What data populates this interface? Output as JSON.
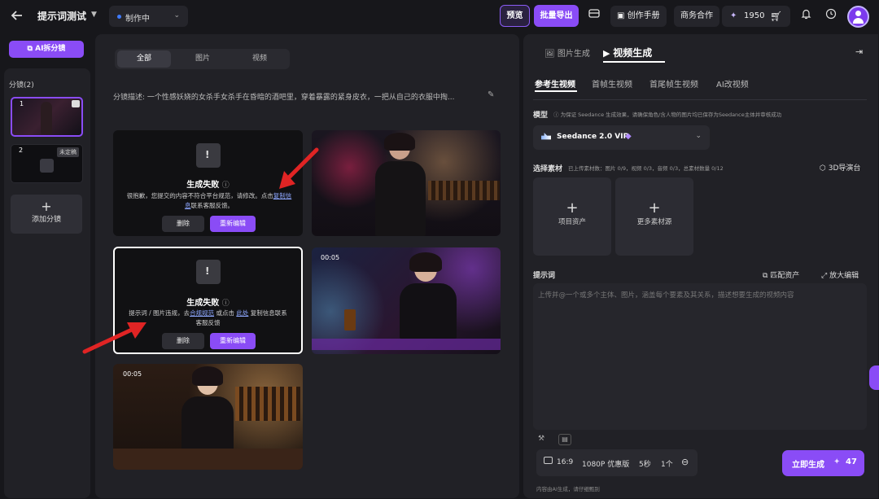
{
  "topbar": {
    "title": "提示词测试",
    "status": "制作中",
    "preview": "预览",
    "batch_export": "批量导出",
    "creation_manual": "创作手册",
    "business": "商务合作",
    "credits": "1950"
  },
  "left": {
    "ai_split": "AI拆分镜",
    "shots_label": "分镜(2)",
    "shot1_num": "1",
    "shot2_num": "2",
    "shot2_badge": "未定稿",
    "add_shot": "添加分镜"
  },
  "middle": {
    "tabs": [
      "全部",
      "图片",
      "视频"
    ],
    "description": "分镜描述: 一个性感妖娆的女杀手女杀手在昏暗的酒吧里，穿着暴露的紧身皮衣，一把从自己的衣服中掏...",
    "card1": {
      "title": "生成失败",
      "msg_a": "很抱歉，您提交的内容不符合平台规范，请修改。点击",
      "msg_link": "复制信息",
      "msg_b": "联系客服反馈。",
      "delete": "删除",
      "reedit": "重新编辑"
    },
    "card3": {
      "title": "生成失败",
      "msg_a": "提示词 / 图片违规，去",
      "msg_link1": "合规规范",
      "msg_mid": "或点击",
      "msg_link2": "此处",
      "msg_b": "复制信息联系",
      "msg_c": "客服反馈",
      "delete": "删除",
      "reedit": "重新编辑"
    },
    "dur_video1": "00:05",
    "dur_video2": "00:05"
  },
  "right": {
    "tab_image": "图片生成",
    "tab_video": "视频生成",
    "subtabs": [
      "参考生视频",
      "首帧生视频",
      "首尾帧生视频",
      "AI改视频"
    ],
    "model_label": "模型",
    "model_note": "为保证 Seedance 生成效果，请确保角色/含人物的图片均已保存为Seedance主体并审核成功",
    "model_name": "Seedance 2.0 VIP",
    "material_label": "选择素材",
    "material_note": "已上传素材数：图片 0/9，视频 0/3，音频 0/3，总素材数量 0/12",
    "director": "3D导演台",
    "project_assets": "项目资产",
    "more_materials": "更多素材源",
    "prompt_label": "提示词",
    "match_assets": "匹配资产",
    "expand_edit": "放大编辑",
    "prompt_placeholder": "上传并@一个或多个主体、图片，涵盖每个要素及其关系，描述想要生成的视频内容",
    "ratio": "16:9",
    "resolution": "1080P 优惠版",
    "duration": "5秒",
    "count": "1个",
    "generate": "立即生成",
    "cost": "47",
    "footer": "内容由AI生成，请仔细甄别"
  },
  "colors": {
    "accent": "#8a4cf6",
    "arrow": "#e02424",
    "background": "#17171b",
    "panel": "#212126"
  }
}
